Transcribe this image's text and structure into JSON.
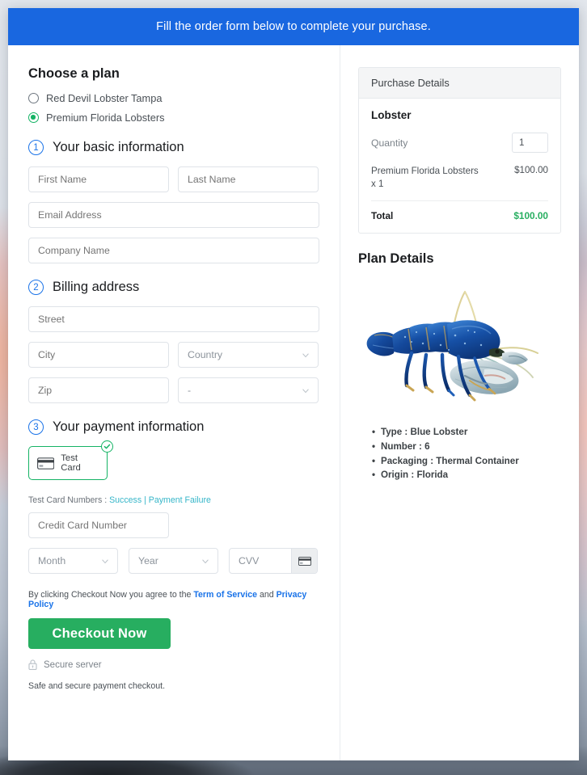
{
  "banner": {
    "text": "Fill the order form below to complete your purchase."
  },
  "plan_section": {
    "title": "Choose a plan",
    "options": [
      {
        "label": "Red Devil Lobster Tampa",
        "selected": false
      },
      {
        "label": "Premium Florida Lobsters",
        "selected": true
      }
    ]
  },
  "step1": {
    "number": "1",
    "title": "Your basic information",
    "fields": {
      "first_name": {
        "placeholder": "First Name",
        "value": ""
      },
      "last_name": {
        "placeholder": "Last Name",
        "value": ""
      },
      "email": {
        "placeholder": "Email Address",
        "value": ""
      },
      "company": {
        "placeholder": "Company Name",
        "value": ""
      }
    }
  },
  "step2": {
    "number": "2",
    "title": "Billing address",
    "fields": {
      "street": {
        "placeholder": "Street",
        "value": ""
      },
      "city": {
        "placeholder": "City",
        "value": ""
      },
      "country": {
        "placeholder": "Country",
        "value": ""
      },
      "zip": {
        "placeholder": "Zip",
        "value": ""
      },
      "state": {
        "placeholder": "-",
        "value": "-"
      }
    }
  },
  "step3": {
    "number": "3",
    "title": "Your payment information",
    "payment_method": {
      "label": "Test Card",
      "selected": true
    },
    "test_numbers": {
      "prefix": "Test Card Numbers : ",
      "success_link": "Success",
      "separator": " | ",
      "failure_link": "Payment Failure"
    },
    "fields": {
      "card_number": {
        "placeholder": "Credit Card Number",
        "value": ""
      },
      "month": {
        "placeholder": "Month",
        "value": ""
      },
      "year": {
        "placeholder": "Year",
        "value": ""
      },
      "cvv": {
        "placeholder": "CVV",
        "value": ""
      }
    }
  },
  "footer": {
    "agree_prefix": "By clicking Checkout Now you agree to the ",
    "terms_link": "Term of Service",
    "agree_middle": " and ",
    "privacy_link": "Privacy Policy",
    "checkout_button": "Checkout Now",
    "secure_server": "Secure server",
    "safe_text": "Safe and secure payment checkout."
  },
  "purchase_details": {
    "header": "Purchase Details",
    "product_name": "Lobster",
    "quantity_label": "Quantity",
    "quantity_value": "1",
    "line_item": {
      "description": "Premium Florida Lobsters x 1",
      "amount": "$100.00"
    },
    "total_label": "Total",
    "total_amount": "$100.00"
  },
  "plan_details": {
    "title": "Plan Details",
    "image_alt": "blue-lobster-photo",
    "bullets": [
      "Type : Blue Lobster",
      "Number : 6",
      "Packaging : Thermal Container",
      "Origin : Florida"
    ]
  },
  "colors": {
    "banner_blue": "#1967e0",
    "accent_green": "#27ae60",
    "radio_green": "#14b364",
    "step_blue": "#1a73e8",
    "link_teal": "#36b6c9",
    "total_green": "#27ae60"
  }
}
